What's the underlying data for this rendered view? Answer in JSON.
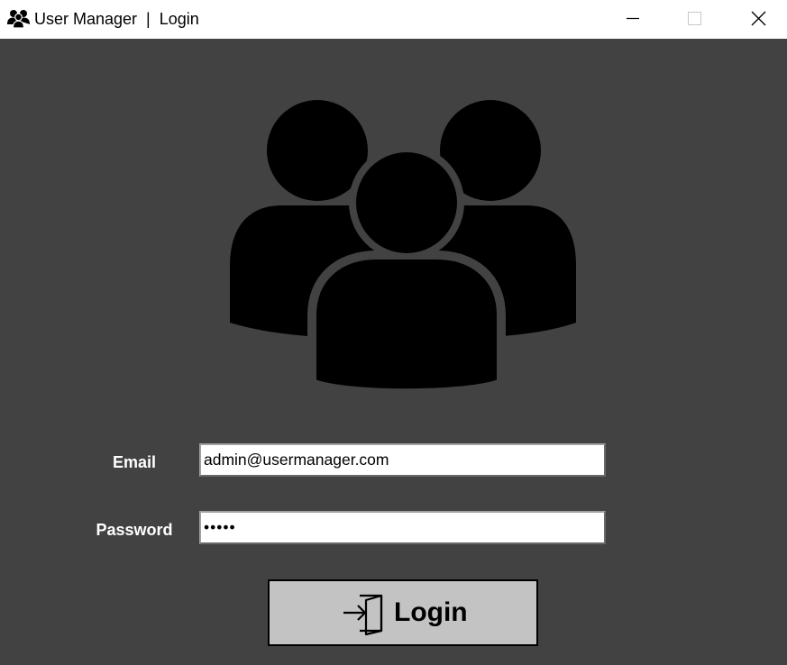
{
  "window": {
    "title": "User Manager  |  Login",
    "app_icon": "users-group-icon",
    "controls": {
      "minimize_icon": "minimize-icon",
      "maximize_icon": "maximize-icon",
      "close_icon": "close-icon"
    }
  },
  "hero": {
    "icon": "users-group-icon"
  },
  "form": {
    "email_label": "Email",
    "email_value": "admin@usermanager.com",
    "password_label": "Password",
    "password_value": "•••••"
  },
  "login_button": {
    "label": "Login",
    "icon": "login-door-icon"
  },
  "colors": {
    "background": "#424242",
    "titlebar": "#ffffff",
    "button": "#c3c3c3",
    "label_text": "#ffffff"
  }
}
